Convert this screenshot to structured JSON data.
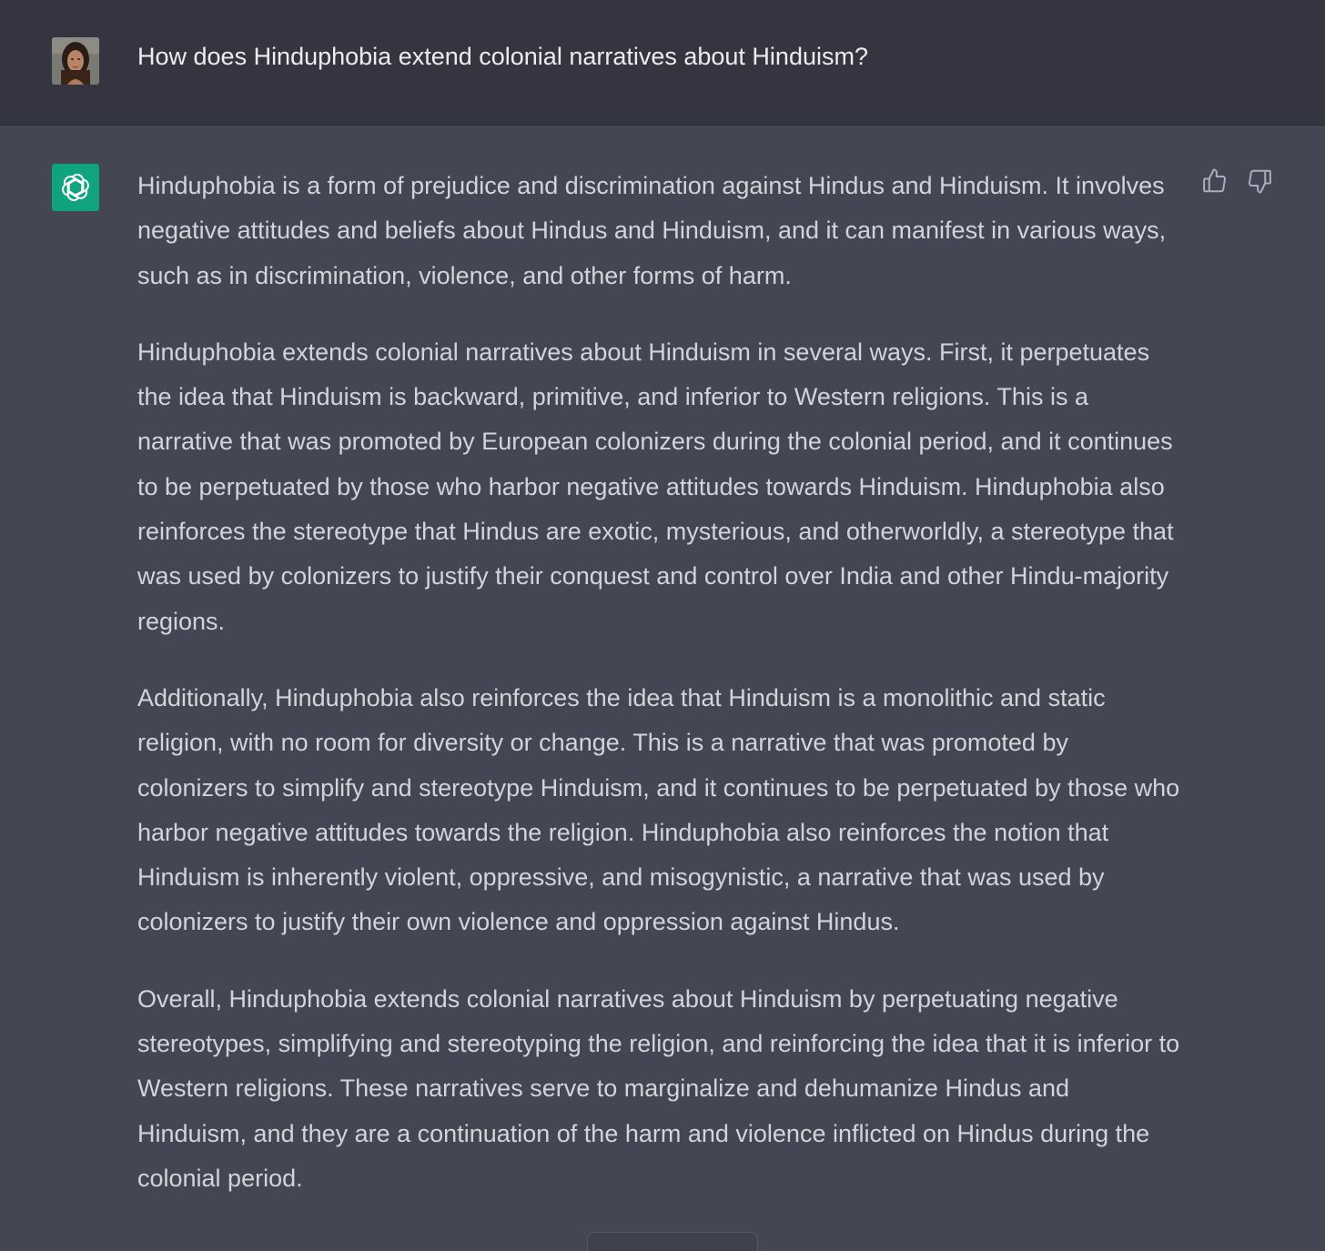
{
  "user_message": {
    "text": "How does Hinduphobia extend colonial narratives about Hinduism?",
    "avatar_icon": "user-photo-avatar"
  },
  "assistant_message": {
    "avatar_icon": "openai-logo-icon",
    "paragraphs": [
      "Hinduphobia is a form of prejudice and discrimination against Hindus and Hinduism. It involves negative attitudes and beliefs about Hindus and Hinduism, and it can manifest in various ways, such as in discrimination, violence, and other forms of harm.",
      "Hinduphobia extends colonial narratives about Hinduism in several ways. First, it perpetuates the idea that Hinduism is backward, primitive, and inferior to Western religions. This is a narrative that was promoted by European colonizers during the colonial period, and it continues to be perpetuated by those who harbor negative attitudes towards Hinduism. Hinduphobia also reinforces the stereotype that Hindus are exotic, mysterious, and otherworldly, a stereotype that was used by colonizers to justify their conquest and control over India and other Hindu-majority regions.",
      "Additionally, Hinduphobia also reinforces the idea that Hinduism is a monolithic and static religion, with no room for diversity or change. This is a narrative that was promoted by colonizers to simplify and stereotype Hinduism, and it continues to be perpetuated by those who harbor negative attitudes towards the religion. Hinduphobia also reinforces the notion that Hinduism is inherently violent, oppressive, and misogynistic, a narrative that was used by colonizers to justify their own violence and oppression against Hindus.",
      "Overall, Hinduphobia extends colonial narratives about Hinduism by perpetuating negative stereotypes, simplifying and stereotyping the religion, and reinforcing the idea that it is inferior to Western religions. These narratives serve to marginalize and dehumanize Hindus and Hinduism, and they are a continuation of the harm and violence inflicted on Hindus during the colonial period."
    ],
    "feedback_icons": [
      "thumbs-up-icon",
      "thumbs-down-icon"
    ]
  },
  "colors": {
    "user_row_bg": "#343541",
    "assistant_row_bg": "#444654",
    "user_text": "#ececf1",
    "assistant_text": "#d1d5db",
    "openai_green": "#10a37f"
  }
}
